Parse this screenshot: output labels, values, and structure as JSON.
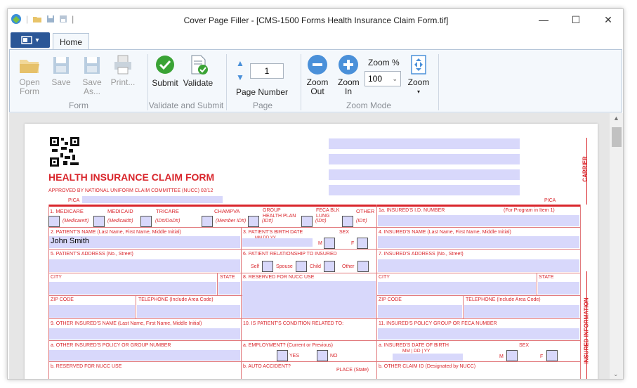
{
  "window": {
    "title": "Cover Page Filler - [CMS-1500 Forms Health Insurance Claim Form.tif]"
  },
  "tabs": {
    "home": "Home"
  },
  "ribbon": {
    "open": "Open Form",
    "save": "Save",
    "save_as": "Save As...",
    "print": "Print...",
    "group_form": "Form",
    "submit": "Submit",
    "validate": "Validate",
    "group_validate": "Validate and Submit",
    "page_number_value": "1",
    "page_number": "Page Number",
    "group_page": "Page",
    "zoom_out": "Zoom Out",
    "zoom_in": "Zoom In",
    "zoom_pct_label": "Zoom %",
    "zoom_pct_value": "100",
    "zoom": "Zoom",
    "group_zoom": "Zoom Mode"
  },
  "form": {
    "title": "HEALTH INSURANCE CLAIM FORM",
    "approved": "APPROVED BY NATIONAL UNIFORM CLAIM COMMITTEE (NUCC) 02/12",
    "pica": "PICA",
    "carrier": "CARRIER",
    "insured_info": "INSURED INFORMATION",
    "row1": [
      "1.  MEDICARE",
      "MEDICAID",
      "TRICARE",
      "CHAMPVA",
      "GROUP HEALTH PLAN",
      "FECA BLK LUNG",
      "OTHER"
    ],
    "row1_sub": [
      "(Medicare#)",
      "(Medicaid#)",
      "(ID#/DoD#)",
      "(Member ID#)",
      "(ID#)",
      "(ID#)",
      "(ID#)"
    ],
    "f1a": "1a. INSURED'S I.D. NUMBER",
    "f1a_note": "(For Program in Item 1)",
    "f2": "2. PATIENT'S NAME (Last Name, First Name, Middle Initial)",
    "f2_value": "John Smith",
    "f3": "3. PATIENT'S BIRTH DATE",
    "f3_mmddyy": "MM   DD   YY",
    "sex": "SEX",
    "m": "M",
    "f": "F",
    "f4": "4. INSURED'S NAME (Last Name, First Name, Middle Initial)",
    "f5": "5. PATIENT'S ADDRESS (No., Street)",
    "f6": "6. PATIENT RELATIONSHIP TO INSURED",
    "self": "Self",
    "spouse": "Spouse",
    "child": "Child",
    "other": "Other",
    "f7": "7. INSURED'S ADDRESS (No., Street)",
    "city": "CITY",
    "state": "STATE",
    "f8": "8. RESERVED FOR NUCC USE",
    "zip": "ZIP CODE",
    "telephone": "TELEPHONE (Include Area Code)",
    "f9": "9. OTHER INSURED'S NAME (Last Name, First Name, Middle Initial)",
    "f10": "10. IS PATIENT'S CONDITION RELATED TO:",
    "f11": "11. INSURED'S POLICY GROUP OR FECA NUMBER",
    "f9a": "a. OTHER INSURED'S POLICY OR GROUP NUMBER",
    "f10a": "a. EMPLOYMENT? (Current or Previous)",
    "yes": "YES",
    "no": "NO",
    "f11a": "a. INSURED'S DATE OF BIRTH",
    "mmddyy": "MM  |  DD  |  YY",
    "f9b": "b. RESERVED FOR NUCC USE",
    "f10b": "b. AUTO ACCIDENT?",
    "place": "PLACE (State)",
    "f11b": "b. OTHER CLAIM ID (Designated by NUCC)"
  },
  "colors": {
    "accent": "#2b5797",
    "form_red": "#d9262c",
    "field_fill": "#d8d8fb",
    "ribbon_bg": "#f4f8fc"
  },
  "icons": [
    "app-icon",
    "open-icon",
    "save-icon",
    "print-icon",
    "submit-icon",
    "validate-icon",
    "zoom-out-icon",
    "zoom-in-icon",
    "zoom-fit-icon",
    "qr-code"
  ]
}
